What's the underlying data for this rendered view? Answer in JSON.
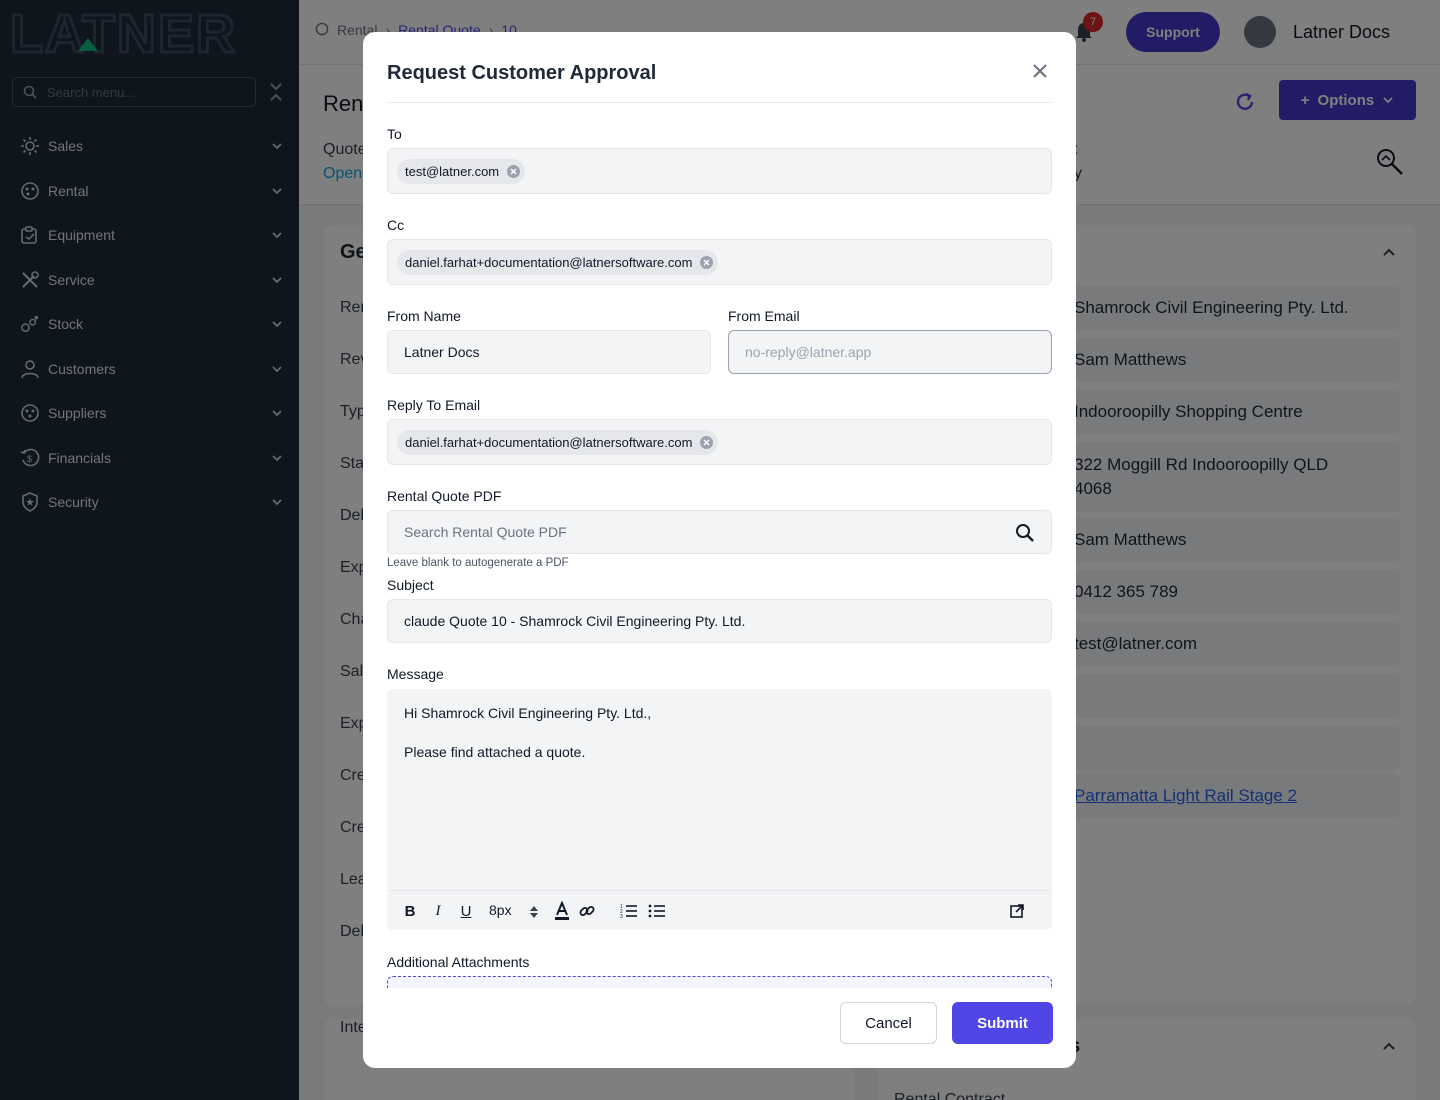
{
  "brand": {
    "logo_text": "LATNER"
  },
  "sidebar": {
    "search_placeholder": "Search menu...",
    "items": [
      {
        "label": "Sales",
        "icon": "sales-icon"
      },
      {
        "label": "Rental",
        "icon": "rental-icon"
      },
      {
        "label": "Equipment",
        "icon": "equipment-icon"
      },
      {
        "label": "Service",
        "icon": "service-icon"
      },
      {
        "label": "Stock",
        "icon": "stock-icon"
      },
      {
        "label": "Customers",
        "icon": "customers-icon"
      },
      {
        "label": "Suppliers",
        "icon": "suppliers-icon"
      },
      {
        "label": "Financials",
        "icon": "financials-icon"
      },
      {
        "label": "Security",
        "icon": "security-icon"
      }
    ]
  },
  "header": {
    "breadcrumb": [
      "Rental",
      "Rental Quote",
      "10"
    ],
    "notifications_count": "7",
    "support_label": "Support",
    "user_name": "Latner Docs"
  },
  "page": {
    "title": "Ren",
    "options_label": "Options",
    "quote_label": "Quote",
    "status_link": "Open",
    "side_label_colon": ":",
    "side_value": "y",
    "left_card_title": "Ge",
    "left_labels": [
      "Ren",
      "Rev",
      "Typ",
      "Sta",
      "Del",
      "Exp",
      "Cha",
      "Sal",
      "Exp",
      "Cre",
      "Cre",
      "Lea",
      "Del"
    ],
    "left_card2_label": "Inte",
    "right_values": [
      "Shamrock Civil Engineering Pty. Ltd.",
      "Sam Matthews",
      "Indooroopilly Shopping Centre",
      "322 Moggill Rd Indooroopilly QLD 4068",
      "Sam Matthews",
      "0412 365 789",
      "test@latner.com",
      "",
      "",
      "Parramatta Light Rail Stage 2"
    ],
    "right_card2_title": "ils",
    "right_card2_label": "Rental Contract"
  },
  "modal": {
    "title": "Request Customer Approval",
    "to_label": "To",
    "to_chips": [
      "test@latner.com"
    ],
    "cc_label": "Cc",
    "cc_chips": [
      "daniel.farhat+documentation@latnersoftware.com"
    ],
    "from_name_label": "From Name",
    "from_name_value": "Latner Docs",
    "from_email_label": "From Email",
    "from_email_placeholder": "no-reply@latner.app",
    "reply_to_label": "Reply To Email",
    "reply_to_chips": [
      "daniel.farhat+documentation@latnersoftware.com"
    ],
    "pdf_label": "Rental Quote PDF",
    "pdf_placeholder": "Search Rental Quote PDF",
    "pdf_help": "Leave blank to autogenerate a PDF",
    "subject_label": "Subject",
    "subject_value": "claude Quote 10 - Shamrock Civil Engineering Pty. Ltd.",
    "message_label": "Message",
    "message_lines": [
      "Hi Shamrock Civil Engineering Pty. Ltd.,",
      "Please find attached a quote."
    ],
    "font_size": "8px",
    "attachments_label": "Additional Attachments",
    "cancel_label": "Cancel",
    "submit_label": "Submit"
  },
  "colors": {
    "sidebar_bg": "#1e2a3b",
    "accent": "#4f46e5",
    "brand_green": "#10b981"
  }
}
